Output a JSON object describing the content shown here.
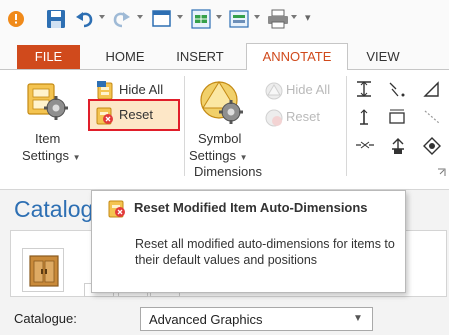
{
  "ribbon_tabs": [
    "FILE",
    "HOME",
    "INSERT",
    "ANNOTATE",
    "VIEW"
  ],
  "active_tab": "ANNOTATE",
  "item_settings": {
    "line1": "Item",
    "line2": "Settings"
  },
  "hide_all_label": "Hide All",
  "reset_label": "Reset",
  "symbol_settings": {
    "line1": "Symbol",
    "line2": "Settings"
  },
  "disabled_hide_all_label": "Hide All",
  "disabled_reset_label": "Reset",
  "group_label": "Dimensions",
  "tooltip": {
    "title": "Reset Modified Item Auto-Dimensions",
    "body": "Reset all modified auto-dimensions for items to their default values and positions"
  },
  "catalogue_heading": "Catalog",
  "catalogue_label": "Catalogue:",
  "catalogue_value": "Advanced Graphics",
  "colors": {
    "file_tab": "#d04a1c",
    "accent": "#d04a1c",
    "highlight_border": "#e01e2a",
    "hover_fill": "#fde7c7"
  }
}
